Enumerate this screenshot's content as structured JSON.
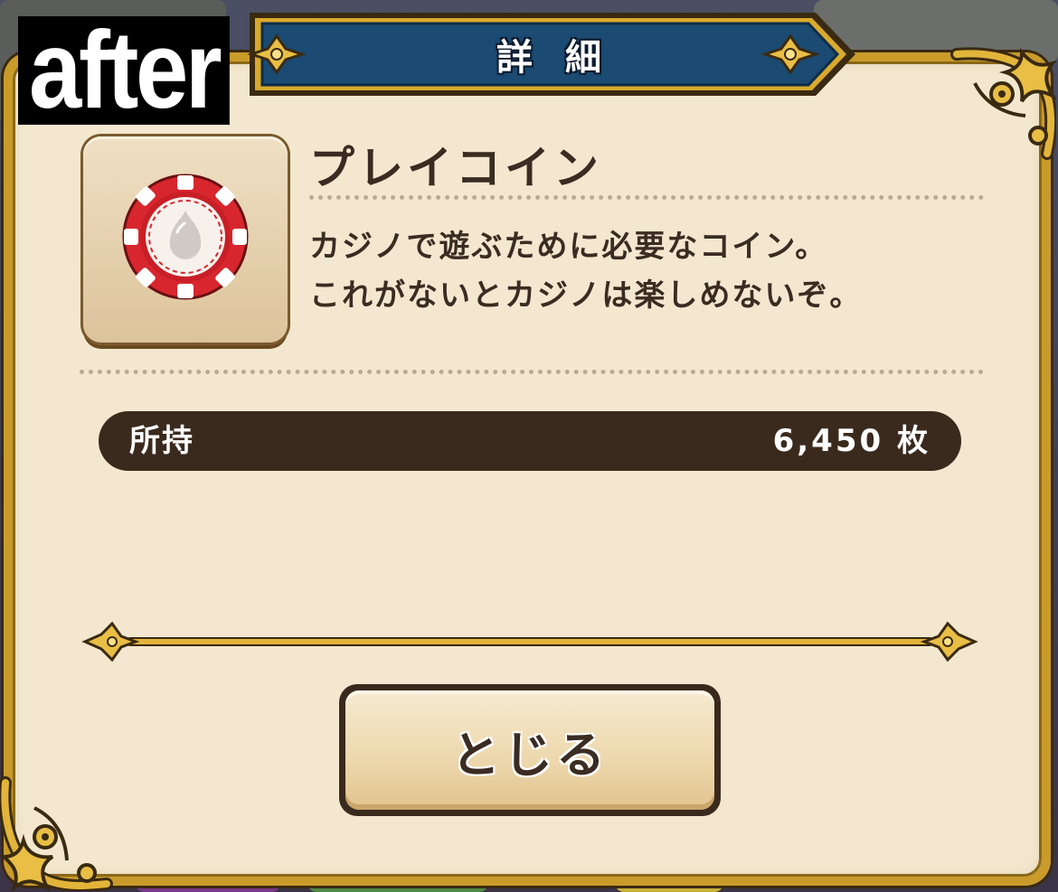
{
  "overlay_label": "after",
  "dialog": {
    "title": "詳細",
    "item": {
      "name": "プレイコイン",
      "description_lines": [
        "カジノで遊ぶために必要なコイン。",
        "これがないとカジノは楽しめないぞ。"
      ],
      "icon": "casino-chip-icon"
    },
    "owned": {
      "label": "所持",
      "value": "6,450 枚"
    },
    "close_button": {
      "label": "とじる"
    }
  },
  "colors": {
    "frame_gold": "#c99b2a",
    "panel_cream": "#f3e8cf",
    "ribbon_blue": "#1b4a72",
    "dark_brown": "#3a2a1e",
    "chip_red": "#d8262e"
  }
}
